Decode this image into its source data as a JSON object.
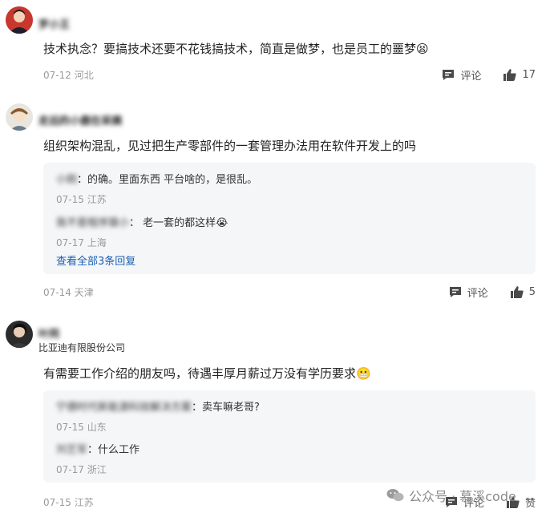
{
  "comments": [
    {
      "username": "罗小王",
      "content": "技术执念？要搞技术还要不花钱搞技术，简直是做梦，也是员工的噩梦",
      "emoji": "😫",
      "date": "07-12",
      "location": "河北",
      "comment_label": "评论",
      "like_count": "17"
    },
    {
      "username": "走远的小鹿在采摘",
      "content": "组织架构混乱，见过把生产零部件的一套管理办法用在软件开发上的吗",
      "date": "07-14",
      "location": "天津",
      "comment_label": "评论",
      "like_count": "5",
      "replies": [
        {
          "author": "小刚",
          "text": "：的确。里面东西 平台啥的，是很乱。",
          "date": "07-15",
          "location": "江苏"
        },
        {
          "author": "我不是程序猿小",
          "text": "：  老一套的都这样",
          "emoji": "😭",
          "date": "07-17",
          "location": "上海"
        }
      ],
      "view_all": "查看全部3条回复"
    },
    {
      "username": "叶同",
      "company": "比亚迪有限股份公司",
      "content": "有需要工作介绍的朋友吗，待遇丰厚月薪过万没有学历要求",
      "emoji": "😬",
      "date": "07-15",
      "location": "江苏",
      "comment_label": "评论",
      "like_label": "赞",
      "replies": [
        {
          "author": "宁德时代新能源科技解决方案",
          "text": "：卖车嘛老哥?",
          "date": "07-15",
          "location": "山东"
        },
        {
          "author": "刘艺军",
          "text": "：什么工作",
          "date": "07-17",
          "location": "浙江"
        }
      ]
    }
  ],
  "watermark": "公众号 · 慕溪code"
}
